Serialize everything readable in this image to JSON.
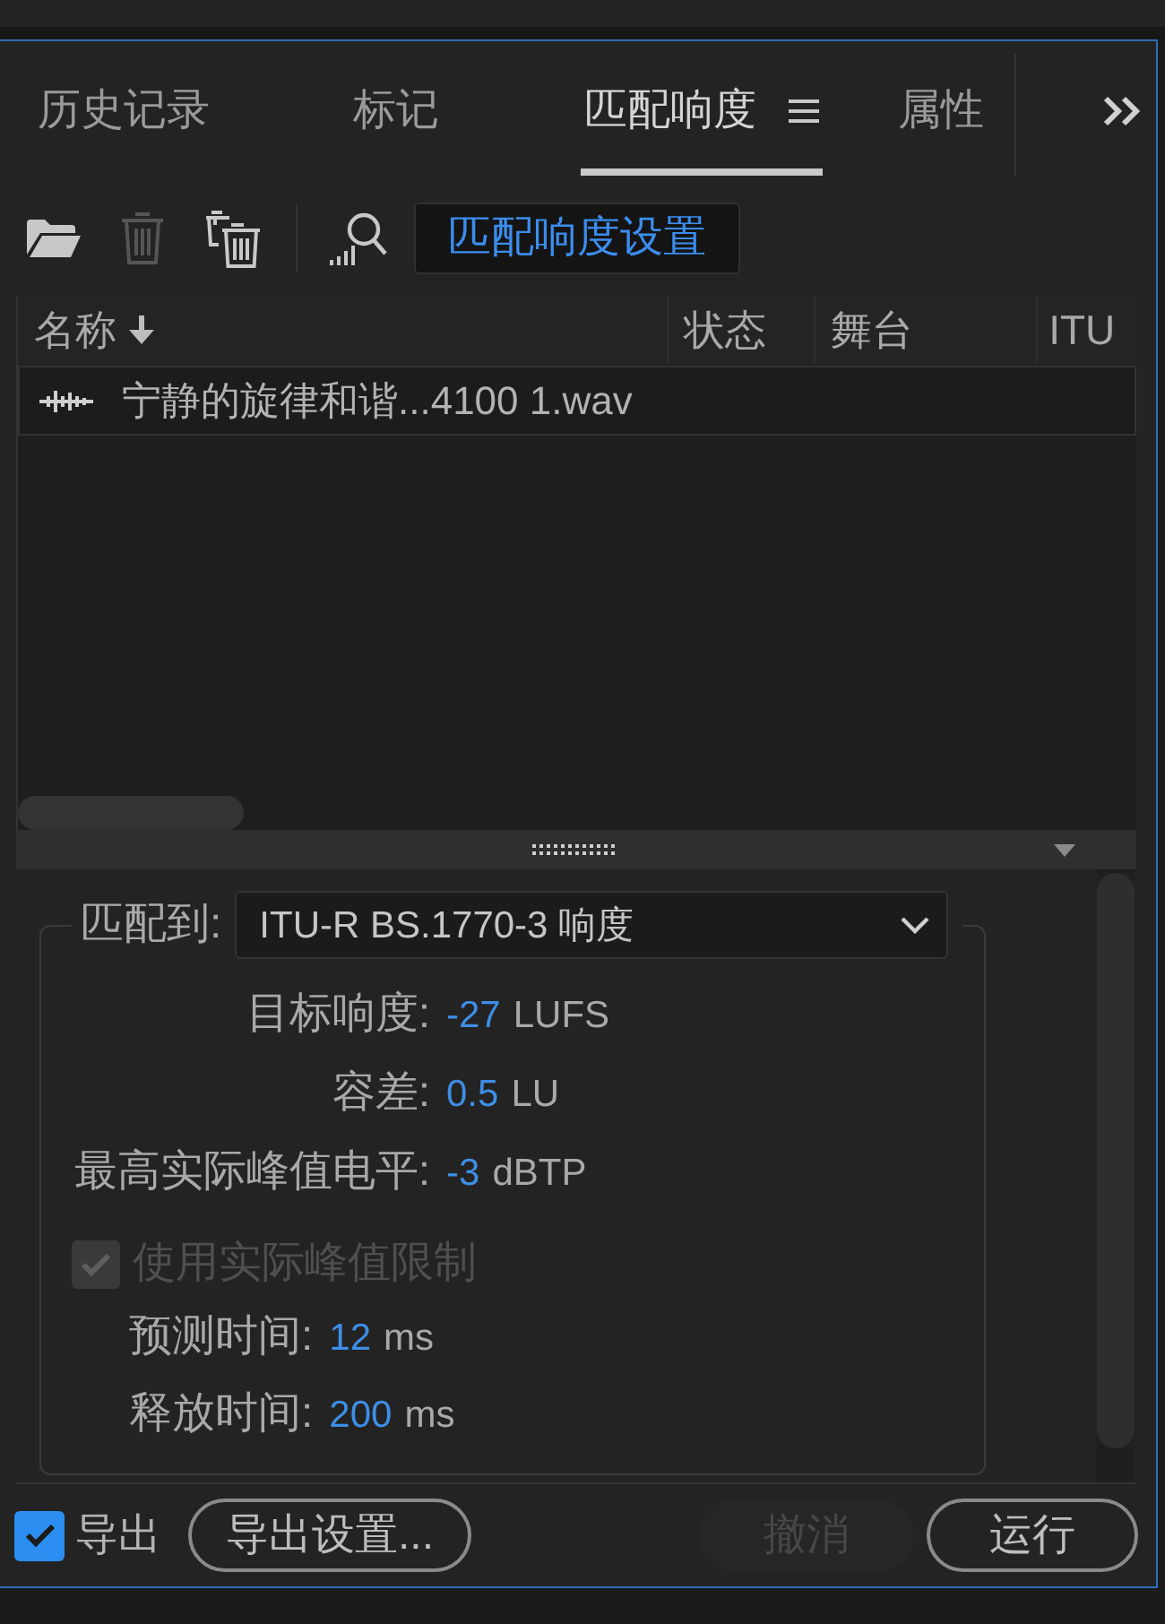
{
  "tabs": [
    {
      "label": "历史记录",
      "selected": false
    },
    {
      "label": "标记",
      "selected": false
    },
    {
      "label": "匹配响度",
      "selected": true
    },
    {
      "label": "属性",
      "selected": false
    }
  ],
  "toolbar": {
    "open": {
      "disabled": false
    },
    "remove": {
      "disabled": true
    },
    "clear": {
      "disabled": false
    },
    "scan": {
      "disabled": false
    },
    "settings_button": {
      "label": "匹配响度设置"
    }
  },
  "table": {
    "columns": [
      {
        "label": "名称",
        "sorted": true
      },
      {
        "label": "状态",
        "sorted": false
      },
      {
        "label": "舞台",
        "sorted": false
      },
      {
        "label": "ITU",
        "sorted": false
      }
    ],
    "rows": [
      {
        "name": "宁静的旋律和谐...4100 1.wav"
      }
    ]
  },
  "settings": {
    "match_to": {
      "label": "匹配到:",
      "value": "ITU-R BS.1770-3 响度"
    },
    "fields": [
      {
        "label": "目标响度:",
        "value": "-27",
        "unit": "LUFS"
      },
      {
        "label": "容差:",
        "value": "0.5",
        "unit": "LU"
      },
      {
        "label": "最高实际峰值电平:",
        "value": "-3",
        "unit": "dBTP"
      }
    ],
    "true_peak_limit": {
      "label": "使用实际峰值限制",
      "checked": true,
      "disabled": true
    },
    "limiter_fields": [
      {
        "label": "预测时间:",
        "value": "12",
        "unit": "ms"
      },
      {
        "label": "释放时间:",
        "value": "200",
        "unit": "ms"
      }
    ]
  },
  "footer": {
    "export": {
      "label": "导出",
      "checked": true
    },
    "buttons": [
      {
        "label": "导出设置...",
        "disabled": false
      },
      {
        "label": "撤消",
        "disabled": true
      },
      {
        "label": "运行",
        "disabled": false
      }
    ]
  }
}
